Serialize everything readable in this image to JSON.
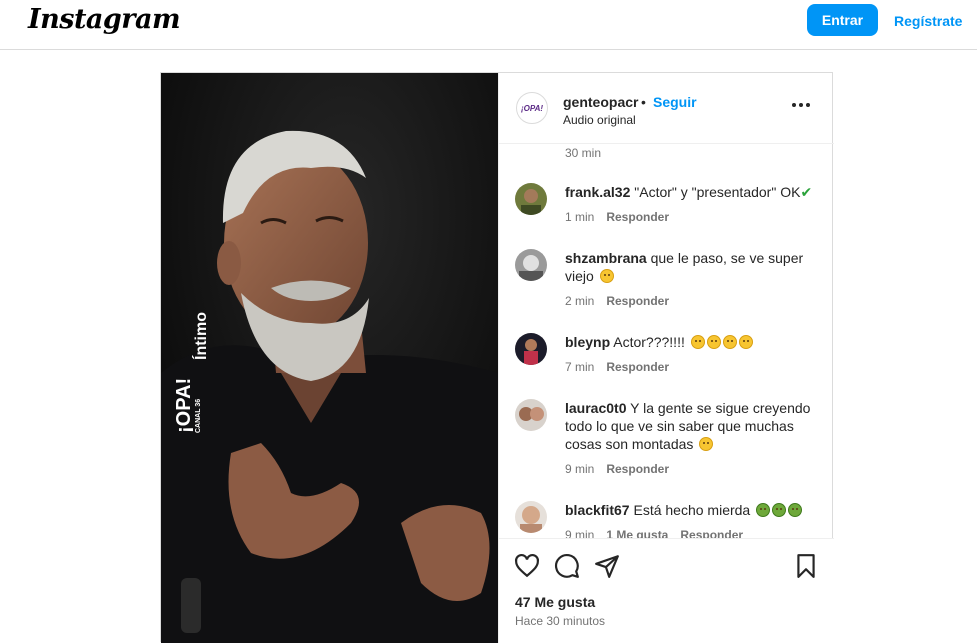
{
  "header": {
    "logo": "Instagram",
    "login_label": "Entrar",
    "signup_label": "Regístrate"
  },
  "post": {
    "username": "genteopacr",
    "separator": "•",
    "follow_label": "Seguir",
    "audio": "Audio original",
    "more_label": "•••",
    "avatar_text": "¡OPA!",
    "watermark": {
      "brand": "¡OPA!",
      "channel": "CANAL 36",
      "show": "Íntimo"
    },
    "earlier_time": "30 min",
    "comments": [
      {
        "user": "frank.al32",
        "text": "\"Actor\" y \"presentador\" OK",
        "suffix": "✔",
        "time": "1 min",
        "reply": "Responder"
      },
      {
        "user": "shzambrana",
        "text": "que le paso, se ve super viejo",
        "emoji": "yellow",
        "time": "2 min",
        "reply": "Responder"
      },
      {
        "user": "bleynp",
        "text": "Actor???!!!!",
        "emoji_count": 4,
        "time": "7 min",
        "reply": "Responder"
      },
      {
        "user": "laurac0t0",
        "text": "Y la gente se sigue creyendo todo lo que ve sin saber que muchas cosas son montadas",
        "emoji": "yellow",
        "time": "9 min",
        "reply": "Responder"
      },
      {
        "user": "blackfit67",
        "text": "Está hecho mierda",
        "emoji_count": 3,
        "time": "9 min",
        "likes": "1 Me gusta",
        "reply": "Responder"
      }
    ],
    "like_count": "47 Me gusta",
    "posted": "Hace 30 minutos"
  },
  "icons": {
    "like": "heart-icon",
    "comment": "comment-icon",
    "share": "paper-plane-icon",
    "save": "bookmark-icon",
    "more": "more-dots-icon",
    "verified": "check-icon"
  },
  "colors": {
    "accent": "#0095f6",
    "border": "#dbdbdb",
    "muted": "#737373"
  }
}
